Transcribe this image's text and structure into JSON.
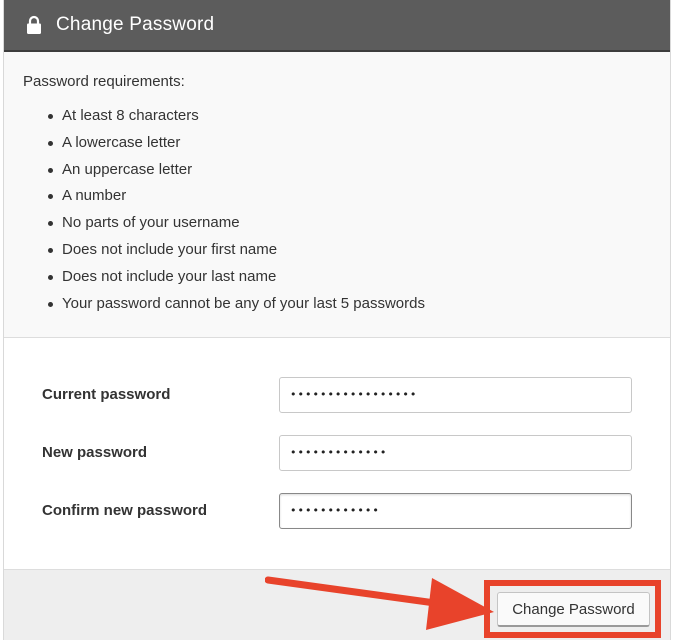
{
  "header": {
    "title": "Change Password",
    "icon": "lock-icon",
    "background": "#5c5c5c"
  },
  "requirements": {
    "title": "Password requirements:",
    "items": [
      "At least 8 characters",
      "A lowercase letter",
      "An uppercase letter",
      "A number",
      "No parts of your username",
      "Does not include your first name",
      "Does not include your last name",
      "Your password cannot be any of your last 5 passwords"
    ]
  },
  "form": {
    "current_password": {
      "label": "Current password",
      "value": "•••••••••••••••••"
    },
    "new_password": {
      "label": "New password",
      "value": "•••••••••••••"
    },
    "confirm_password": {
      "label": "Confirm new password",
      "value": "••••••••••••"
    }
  },
  "footer": {
    "submit_label": "Change Password"
  },
  "annotation": {
    "color": "#e8432b",
    "arrow_icon": "arrow-right-icon"
  }
}
